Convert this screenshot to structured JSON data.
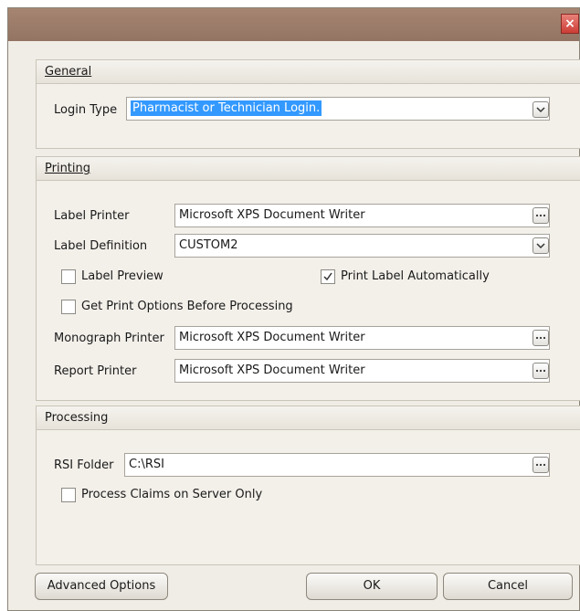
{
  "window": {
    "close_label": "×"
  },
  "general": {
    "header": "General",
    "login_type_label": "Login Type",
    "login_type_value": "Pharmacist or Technician Login."
  },
  "printing": {
    "header": "Printing",
    "label_printer_label": "Label Printer",
    "label_printer_value": "Microsoft XPS Document Writer",
    "label_definition_label": "Label Definition",
    "label_definition_value": "CUSTOM2",
    "label_preview_label": "Label Preview",
    "label_preview_checked": false,
    "print_label_auto_label": "Print Label Automatically",
    "print_label_auto_checked": true,
    "get_print_options_label": "Get Print Options Before Processing",
    "get_print_options_checked": false,
    "monograph_printer_label": "Monograph Printer",
    "monograph_printer_value": "Microsoft XPS Document Writer",
    "report_printer_label": "Report Printer",
    "report_printer_value": "Microsoft XPS Document Writer"
  },
  "processing": {
    "header": "Processing",
    "rsi_folder_label": "RSI Folder",
    "rsi_folder_value": "C:\\RSI",
    "process_claims_label": "Process Claims on Server Only",
    "process_claims_checked": false
  },
  "buttons": {
    "advanced_label": "Advanced Options",
    "ok_label": "OK",
    "cancel_label": "Cancel"
  }
}
